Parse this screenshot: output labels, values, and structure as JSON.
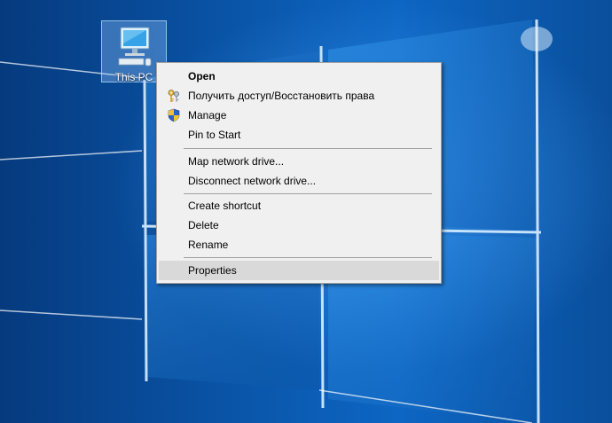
{
  "desktop": {
    "icon_label": "This PC"
  },
  "menu": {
    "items": [
      {
        "label": "Open",
        "bold": true
      },
      {
        "label": "Получить доступ/Восстановить права",
        "icon": "keys-icon"
      },
      {
        "label": "Manage",
        "icon": "uac-shield-icon"
      },
      {
        "label": "Pin to Start"
      },
      {
        "label": "Map network drive..."
      },
      {
        "label": "Disconnect network drive..."
      },
      {
        "label": "Create shortcut"
      },
      {
        "label": "Delete"
      },
      {
        "label": "Rename"
      },
      {
        "label": "Properties",
        "highlighted": true
      }
    ]
  },
  "colors": {
    "menu_background": "#f0f0f0",
    "menu_highlight": "#d9d9d9",
    "wallpaper_blue": "#0a56aa"
  }
}
